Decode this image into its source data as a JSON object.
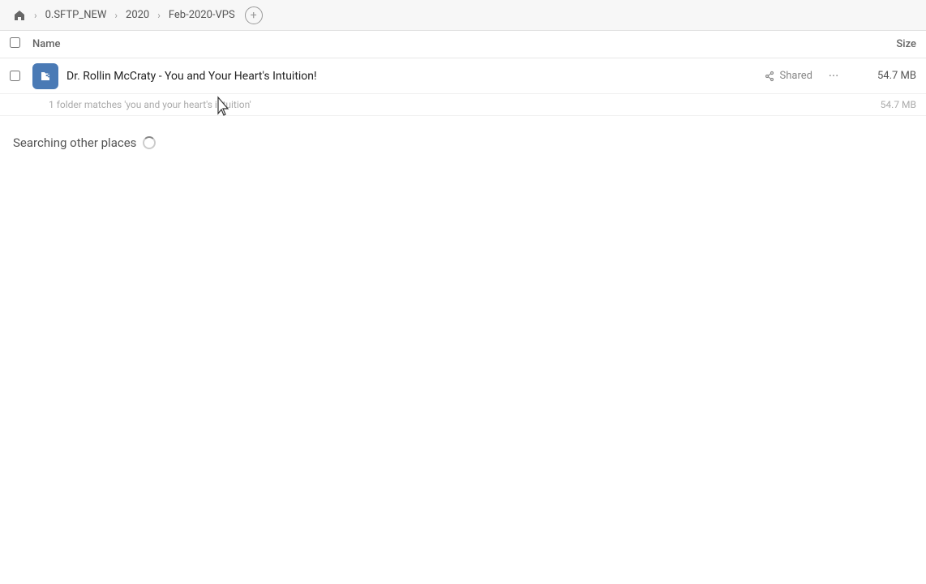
{
  "breadcrumb": {
    "home_label": "Home",
    "items": [
      {
        "label": "0.SFTP_NEW"
      },
      {
        "label": "2020"
      },
      {
        "label": "Feb-2020-VPS"
      }
    ],
    "add_tooltip": "Add"
  },
  "columns": {
    "name_label": "Name",
    "size_label": "Size"
  },
  "file_row": {
    "name": "Dr. Rollin McCraty - You and Your Heart's Intuition!",
    "shared_label": "Shared",
    "size": "54.7 MB"
  },
  "summary": {
    "text": "1 folder matches 'you and your heart's intuition'",
    "size": "54.7 MB"
  },
  "searching": {
    "label": "Searching other places"
  }
}
